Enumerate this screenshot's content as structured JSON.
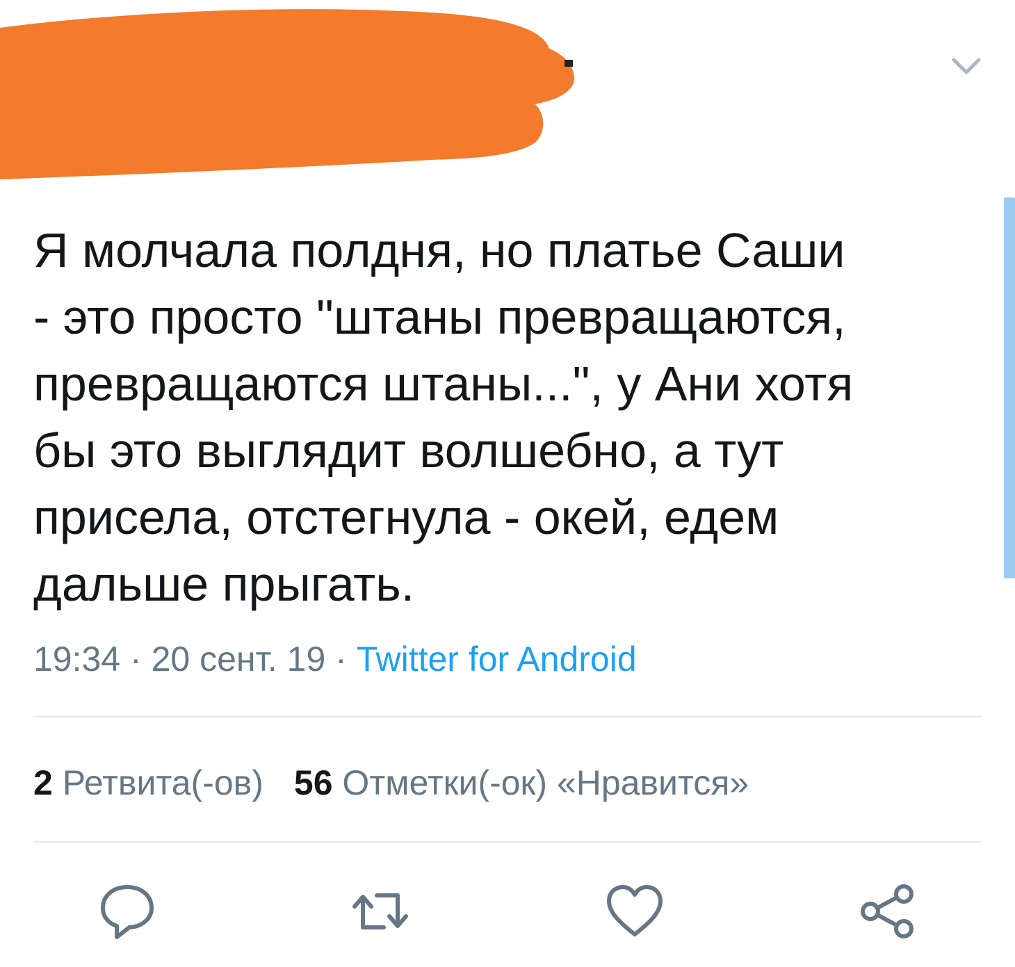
{
  "tweet": {
    "text": "Я молчала полдня, но платье Саши\n- это просто \"штаны превращаются,\nпревращаются штаны...\", у Ани хотя\nбы это выглядит волшебно, а тут\nприсела, отстегнула - окей, едем\nдальше прыгать.",
    "time": "19:34",
    "date": "20 сент. 19",
    "separator": " · ",
    "source": "Twitter for Android"
  },
  "stats": {
    "retweets_count": "2",
    "retweets_label": "Ретвита(-ов)",
    "likes_count": "56",
    "likes_label": "Отметки(-ок) «Нравится»"
  },
  "actions": [
    {
      "icon": "reply-icon"
    },
    {
      "icon": "retweet-icon"
    },
    {
      "icon": "like-icon"
    },
    {
      "icon": "share-icon"
    }
  ],
  "colors": {
    "redaction": "#f47a2c",
    "text": "#14171a",
    "secondary": "#657786",
    "link": "#1da1f2",
    "icon": "#657786",
    "divider": "#e1e8ed",
    "scrollbar": "#9ccbf2"
  }
}
